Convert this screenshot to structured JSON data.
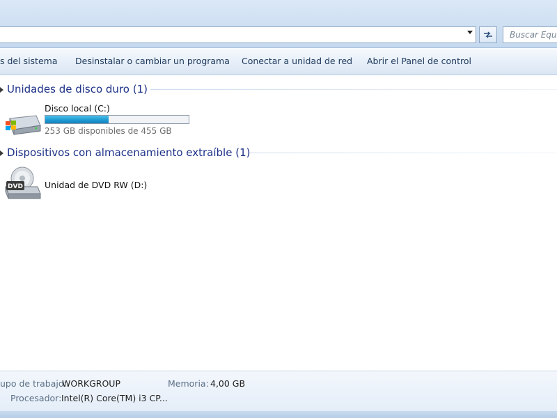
{
  "address_bar": {
    "path": ""
  },
  "search": {
    "placeholder": "Buscar Equipo"
  },
  "command_bar": {
    "items": [
      "s del sistema",
      "Desinstalar o cambiar un programa",
      "Conectar a unidad de red",
      "Abrir el Panel de control"
    ]
  },
  "groups": {
    "hard_disks": {
      "title": "Unidades de disco duro (1)",
      "drive": {
        "name": "Disco local (C:)",
        "free_text": "253 GB disponibles de 455 GB",
        "used_fraction": 0.444
      }
    },
    "removable": {
      "title": "Dispositivos con almacenamiento extraíble (1)",
      "drive": {
        "name": "Unidad de DVD RW (D:)",
        "icon_label": "DVD"
      }
    }
  },
  "details": {
    "workgroup_label": "upo de trabajo:",
    "workgroup_value": "WORKGROUP",
    "memory_label": "Memoria:",
    "memory_value": "4,00 GB",
    "processor_label": "Procesador:",
    "processor_value": "Intel(R) Core(TM) i3 CP..."
  },
  "icons": {
    "refresh": "refresh-icon",
    "dropdown": "chevron-down-icon",
    "hdd": "hard-drive-icon",
    "dvd": "dvd-drive-icon"
  },
  "colors": {
    "group_title": "#1e3287",
    "bar_fill": "#1f9bd3",
    "command_text": "#1e395b"
  }
}
